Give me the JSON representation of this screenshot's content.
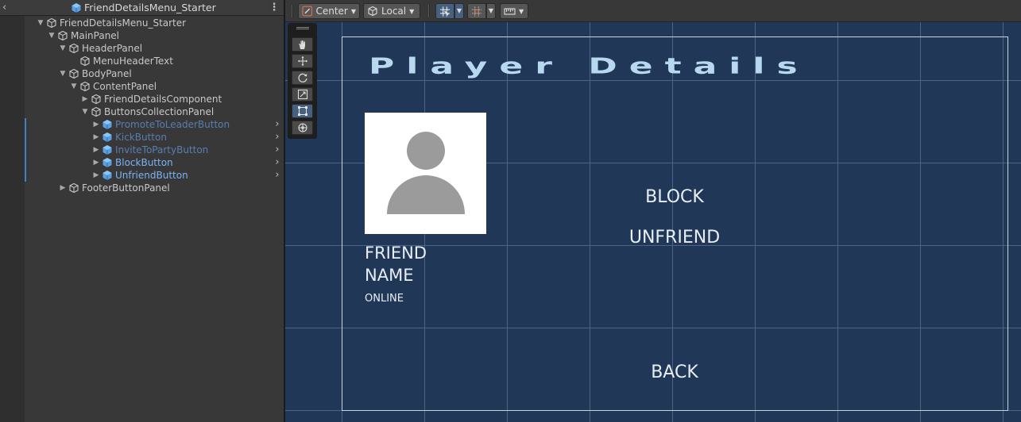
{
  "hierarchy": {
    "title": "FriendDetailsMenu_Starter",
    "back_glyph": "‹",
    "menu_glyph": "⋮",
    "items": [
      {
        "label": "FriendDetailsMenu_Starter",
        "depth": 0,
        "expanded": true,
        "style": "normal",
        "has_children": true
      },
      {
        "label": "MainPanel",
        "depth": 1,
        "expanded": true,
        "style": "normal",
        "has_children": true
      },
      {
        "label": "HeaderPanel",
        "depth": 2,
        "expanded": true,
        "style": "normal",
        "has_children": true
      },
      {
        "label": "MenuHeaderText",
        "depth": 3,
        "expanded": false,
        "style": "normal",
        "has_children": false
      },
      {
        "label": "BodyPanel",
        "depth": 2,
        "expanded": true,
        "style": "normal",
        "has_children": true
      },
      {
        "label": "ContentPanel",
        "depth": 3,
        "expanded": true,
        "style": "normal",
        "has_children": true
      },
      {
        "label": "FriendDetailsComponent",
        "depth": 4,
        "expanded": false,
        "style": "normal",
        "has_children": true
      },
      {
        "label": "ButtonsCollectionPanel",
        "depth": 4,
        "expanded": true,
        "style": "normal",
        "has_children": true
      },
      {
        "label": "PromoteToLeaderButton",
        "depth": 5,
        "expanded": false,
        "style": "dim",
        "has_children": true,
        "prefab": true
      },
      {
        "label": "KickButton",
        "depth": 5,
        "expanded": false,
        "style": "dim",
        "has_children": true,
        "prefab": true
      },
      {
        "label": "InviteToPartyButton",
        "depth": 5,
        "expanded": false,
        "style": "dim",
        "has_children": true,
        "prefab": true
      },
      {
        "label": "BlockButton",
        "depth": 5,
        "expanded": false,
        "style": "bright",
        "has_children": true,
        "prefab": true
      },
      {
        "label": "UnfriendButton",
        "depth": 5,
        "expanded": false,
        "style": "bright",
        "has_children": true,
        "prefab": true
      },
      {
        "label": "FooterButtonPanel",
        "depth": 2,
        "expanded": false,
        "style": "normal",
        "has_children": true
      }
    ]
  },
  "toolbar": {
    "pivot_mode": "Center",
    "pivot_rotation": "Local"
  },
  "scene": {
    "header_text": "Player Details",
    "friend_name": "FRIEND NAME",
    "friend_status": "ONLINE",
    "buttons": {
      "block": "BLOCK",
      "unfriend": "UNFRIEND",
      "back": "BACK"
    }
  },
  "colors": {
    "scene_bg": "#203758",
    "header_text": "#b7d8ef",
    "prefab_icon": "#5aa0e0",
    "active_tool": "#46607f"
  }
}
